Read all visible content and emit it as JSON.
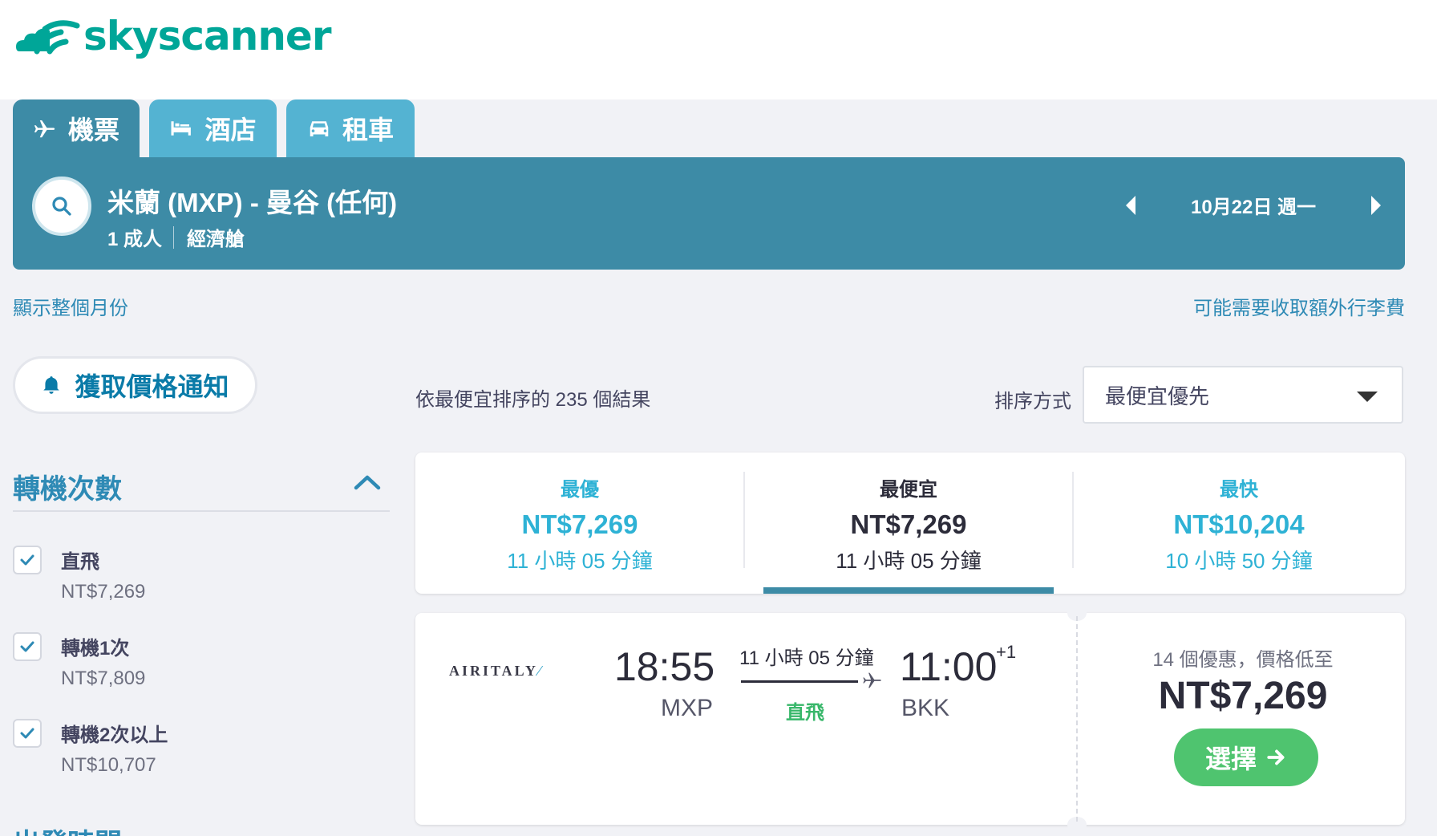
{
  "brand": {
    "name": "skyscanner"
  },
  "tabs": [
    {
      "label": "機票",
      "icon": "plane-icon"
    },
    {
      "label": "酒店",
      "icon": "bed-icon"
    },
    {
      "label": "租車",
      "icon": "car-icon"
    }
  ],
  "search": {
    "route": "米蘭 (MXP) - 曼谷 (任何)",
    "passengers": "1 成人",
    "cabin": "經濟艙",
    "date": "10月22日 週一"
  },
  "links": {
    "show_month": "顯示整個月份",
    "baggage_fees": "可能需要收取額外行李費"
  },
  "price_alert": {
    "label": "獲取價格通知"
  },
  "filters": {
    "stops_title": "轉機次數",
    "stops": [
      {
        "label": "直飛",
        "price": "NT$7,269",
        "checked": true
      },
      {
        "label": "轉機1次",
        "price": "NT$7,809",
        "checked": true
      },
      {
        "label": "轉機2次以上",
        "price": "NT$10,707",
        "checked": true
      }
    ],
    "departure_title": "出發時間"
  },
  "results": {
    "count_text": "依最便宜排序的 235 個結果",
    "sort_label": "排序方式",
    "sort_value": "最便宜優先"
  },
  "summary": {
    "best": {
      "label": "最優",
      "price": "NT$7,269",
      "duration": "11 小時 05 分鐘"
    },
    "cheapest": {
      "label": "最便宜",
      "price": "NT$7,269",
      "duration": "11 小時 05 分鐘"
    },
    "fastest": {
      "label": "最快",
      "price": "NT$10,204",
      "duration": "10 小時 50 分鐘"
    },
    "selected": "cheapest"
  },
  "flight": {
    "airline": "AIRITALY",
    "dep_time": "18:55",
    "dep_code": "MXP",
    "duration": "11 小時 05 分鐘",
    "stops": "直飛",
    "arr_time": "11:00",
    "arr_day_offset": "+1",
    "arr_code": "BKK",
    "deals": "14 個優惠，價格低至",
    "price": "NT$7,269",
    "select_label": "選擇"
  },
  "colors": {
    "brand_teal": "#00a698",
    "search_bar": "#3d8ba6",
    "tab_inactive": "#54b3d2",
    "link_blue": "#2e8ab5",
    "select_green": "#4fc46f",
    "direct_green": "#38b76a"
  }
}
